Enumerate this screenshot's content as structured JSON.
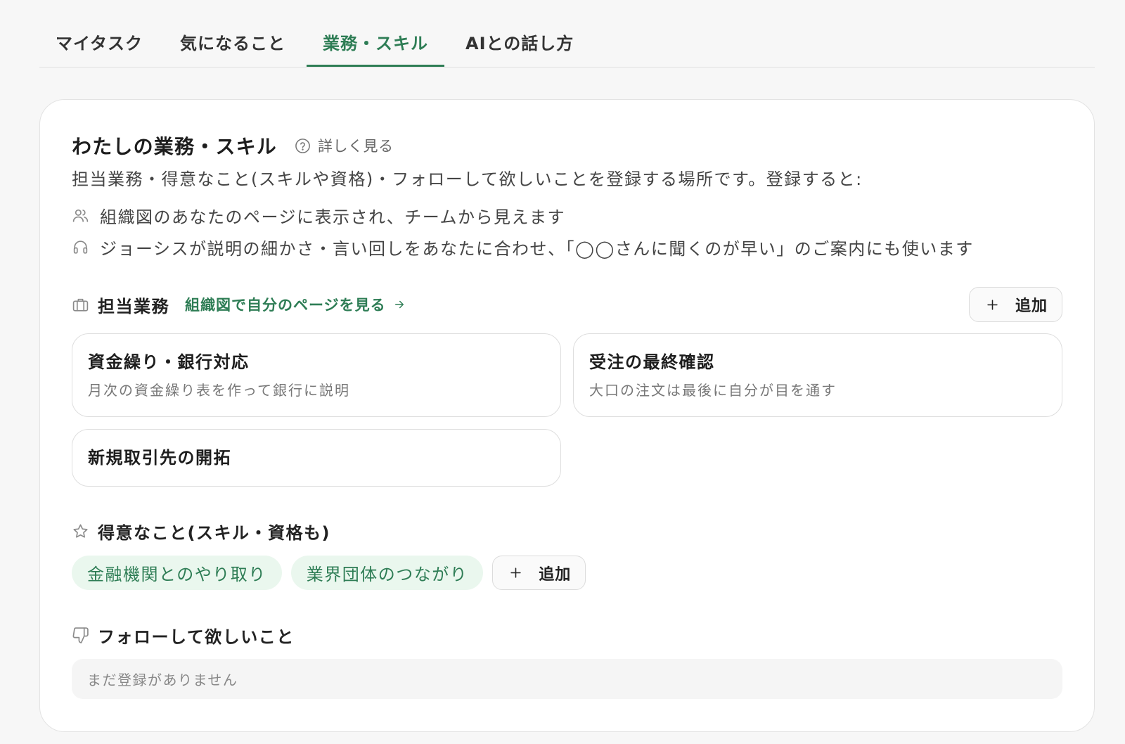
{
  "colors": {
    "accent": "#2e7d55",
    "chip_bg": "#eaf7ee",
    "page_bg": "#f7f7f7",
    "card_bg": "#ffffff"
  },
  "tabs": [
    {
      "label": "マイタスク",
      "active": false
    },
    {
      "label": "気になること",
      "active": false
    },
    {
      "label": "業務・スキル",
      "active": true
    },
    {
      "label": "AIとの話し方",
      "active": false
    }
  ],
  "profile": {
    "title": "わたしの業務・スキル",
    "help": {
      "icon": "question-circle-icon",
      "label": "詳しく見る"
    },
    "description": "担当業務・得意なこと(スキルや資格)・フォローして欲しいことを登録する場所です。登録すると:",
    "benefits": [
      {
        "icon": "people-icon",
        "text": "組織図のあなたのページに表示され、チームから見えます"
      },
      {
        "icon": "headset-icon",
        "text": "ジョーシスが説明の細かさ・言い回しをあなたに合わせ、「◯◯さんに聞くのが早い」のご案内にも使います"
      }
    ]
  },
  "duties": {
    "icon": "briefcase-icon",
    "heading": "担当業務",
    "org_link": {
      "label": "組織図で自分のページを見る",
      "icon": "arrow-right-icon"
    },
    "add_button": {
      "icon": "plus-icon",
      "label": "追加"
    },
    "items": [
      {
        "title": "資金繰り・銀行対応",
        "description": "月次の資金繰り表を作って銀行に説明"
      },
      {
        "title": "受注の最終確認",
        "description": "大口の注文は最後に自分が目を通す"
      },
      {
        "title": "新規取引先の開拓"
      }
    ]
  },
  "skills": {
    "icon": "star-icon",
    "heading": "得意なこと(スキル・資格も)",
    "items": [
      {
        "label": "金融機関とのやり取り"
      },
      {
        "label": "業界団体のつながり"
      }
    ],
    "add_button": {
      "icon": "plus-icon",
      "label": "追加"
    }
  },
  "follow": {
    "icon": "thumbs-down-icon",
    "heading": "フォローして欲しいこと",
    "empty_text": "まだ登録がありません"
  }
}
